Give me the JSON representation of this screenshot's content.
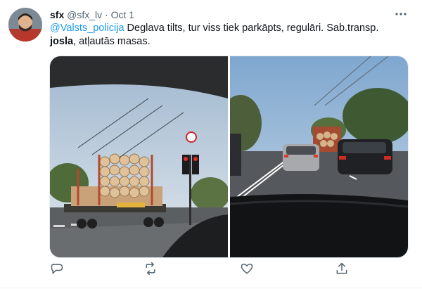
{
  "tweet": {
    "author_name": "sfx",
    "handle": "@sfx_lv",
    "separator": "·",
    "date": "Oct 1",
    "mention": "@Valsts_policija",
    "text_part1": " Deglava tilts, tur viss tiek parkāpts, regulāri. Sab.transp.",
    "text_bold": "josla",
    "text_part2": ", atļautās masas."
  },
  "media": {
    "photo_left_desc": "truck-with-logs-photo",
    "photo_right_desc": "traffic-on-bridge-photo"
  },
  "actions": [
    "reply-icon",
    "retweet-icon",
    "like-icon",
    "share-icon"
  ],
  "colors": {
    "mention": "#1d9bf0",
    "secondary_text": "#536471",
    "icon": "#536471"
  }
}
